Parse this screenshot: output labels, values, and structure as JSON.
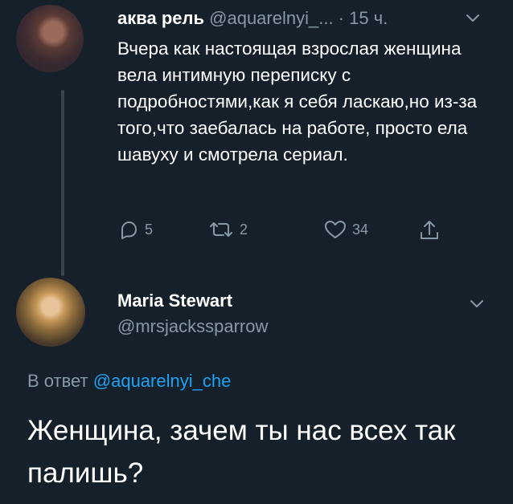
{
  "tweet1": {
    "author_name": "аква рель",
    "handle": "@aquarelnyi_...",
    "separator": "·",
    "time": "15 ч.",
    "text": "Вчера как настоящая взрослая женщина вела интимную переписку с подробностями,как я себя ласкаю,но из-за того,что заебалась на работе, просто ела шавуху и смотрела сериал.",
    "replies": "5",
    "retweets": "2",
    "likes": "34",
    "avatar_icon": "profile-photo"
  },
  "tweet2": {
    "author_name": "Maria Stewart",
    "handle": "@mrsjackssparrow",
    "replying_prefix": "В ответ",
    "replying_to": "@aquarelnyi_che",
    "text": "Женщина, зачем ты нас всех так палишь?",
    "avatar_icon": "profile-photo"
  },
  "colors": {
    "background": "#15202b",
    "secondary_text": "#8899a6",
    "link": "#1da1f2",
    "thread_line": "#38444d"
  },
  "icons": [
    "reply-icon",
    "retweet-icon",
    "like-icon",
    "share-icon",
    "chevron-down-icon"
  ]
}
